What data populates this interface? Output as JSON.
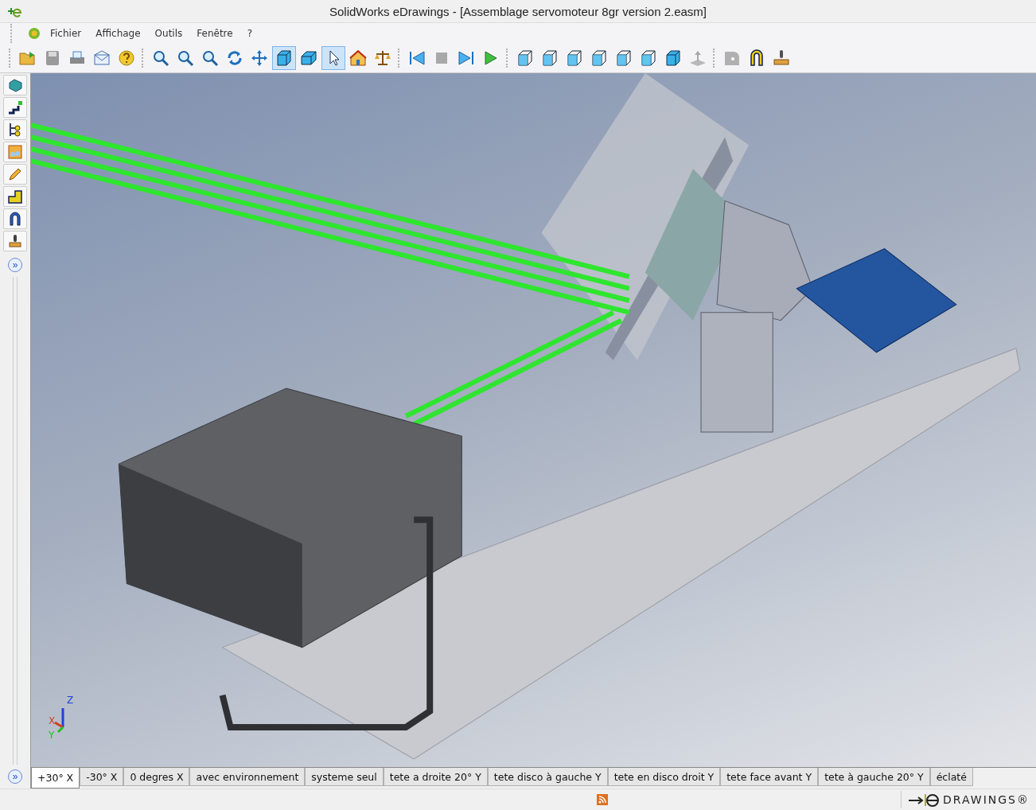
{
  "window": {
    "title": "SolidWorks eDrawings - [Assemblage servomoteur 8gr version 2.easm]"
  },
  "menu": [
    "Fichier",
    "Affichage",
    "Outils",
    "Fenêtre",
    "?"
  ],
  "toolbar": {
    "groups": [
      [
        {
          "kind": "open",
          "selected": false
        },
        {
          "kind": "save",
          "selected": false
        },
        {
          "kind": "print",
          "selected": false
        },
        {
          "kind": "mail",
          "selected": false
        },
        {
          "kind": "help",
          "selected": false
        }
      ],
      [
        {
          "kind": "zoom",
          "selected": false
        },
        {
          "kind": "zoom",
          "selected": false
        },
        {
          "kind": "zoom",
          "selected": false
        },
        {
          "kind": "rotate",
          "selected": false
        },
        {
          "kind": "pan",
          "selected": false
        },
        {
          "kind": "cube",
          "selected": true
        },
        {
          "kind": "box",
          "selected": false
        },
        {
          "kind": "pointer",
          "selected": true
        },
        {
          "kind": "home",
          "selected": false
        },
        {
          "kind": "scale",
          "selected": false
        }
      ],
      [
        {
          "kind": "first",
          "selected": false
        },
        {
          "kind": "stop",
          "selected": false
        },
        {
          "kind": "last",
          "selected": false
        },
        {
          "kind": "play",
          "selected": false
        }
      ],
      [
        {
          "kind": "wirecube",
          "selected": false
        },
        {
          "kind": "wirecube",
          "selected": false
        },
        {
          "kind": "wirecube",
          "selected": false
        },
        {
          "kind": "wirecube",
          "selected": false
        },
        {
          "kind": "wirecube",
          "selected": false
        },
        {
          "kind": "wirecube",
          "selected": false
        },
        {
          "kind": "cube",
          "selected": false
        },
        {
          "kind": "plane",
          "selected": false
        }
      ],
      [
        {
          "kind": "tape",
          "selected": false
        },
        {
          "kind": "section",
          "selected": false
        },
        {
          "kind": "stamp",
          "selected": false
        }
      ]
    ]
  },
  "side_toolbar": [
    {
      "kind": "cube"
    },
    {
      "kind": "steps"
    },
    {
      "kind": "tree"
    },
    {
      "kind": "photo"
    },
    {
      "kind": "pencil"
    },
    {
      "kind": "tape"
    },
    {
      "kind": "section"
    },
    {
      "kind": "stamp"
    }
  ],
  "side_expand": [
    "»",
    "»"
  ],
  "triad": {
    "x": "X",
    "y": "Y",
    "z": "Z"
  },
  "tabs": [
    {
      "label": "+30° X",
      "selected": true
    },
    {
      "label": "-30° X",
      "selected": false
    },
    {
      "label": "0 degres X",
      "selected": false
    },
    {
      "label": "avec environnement",
      "selected": false
    },
    {
      "label": "systeme seul",
      "selected": false
    },
    {
      "label": "tete a droite 20° Y",
      "selected": false
    },
    {
      "label": "tete disco à gauche Y",
      "selected": false
    },
    {
      "label": "tete en disco droit Y",
      "selected": false
    },
    {
      "label": "tete face avant Y",
      "selected": false
    },
    {
      "label": "tete à gauche 20° Y",
      "selected": false
    },
    {
      "label": "éclaté",
      "selected": false
    }
  ],
  "status_bar": {
    "logo": "DRAWINGS®"
  }
}
